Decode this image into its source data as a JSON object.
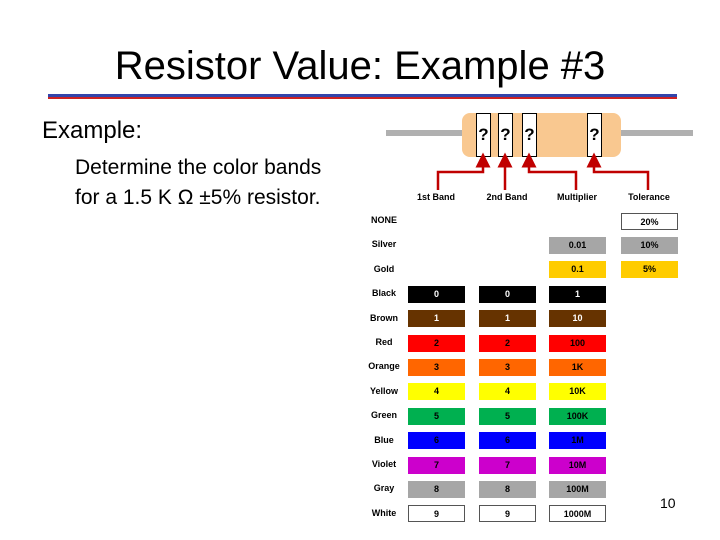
{
  "title": "Resistor Value: Example #3",
  "example_label": "Example:",
  "description": [
    "Determine the color bands",
    "for a 1.5 K Ω  ±5% resistor."
  ],
  "resistor": {
    "band_marks": [
      "?",
      "?",
      "?",
      "?"
    ],
    "body_color": "#f9c890"
  },
  "band_labels": [
    "1st Band",
    "2nd Band",
    "Multiplier",
    "Tolerance"
  ],
  "table": [
    {
      "color": "NONE",
      "hex": "#ffffff",
      "band1": "",
      "band2": "",
      "multiplier": "",
      "tolerance": "20%"
    },
    {
      "color": "Silver",
      "hex": "#a6a6a6",
      "band1": "",
      "band2": "",
      "multiplier": "0.01",
      "tolerance": "10%"
    },
    {
      "color": "Gold",
      "hex": "#ffcc00",
      "band1": "",
      "band2": "",
      "multiplier": "0.1",
      "tolerance": "5%"
    },
    {
      "color": "Black",
      "hex": "#000000",
      "band1": "0",
      "band2": "0",
      "multiplier": "1",
      "tolerance": ""
    },
    {
      "color": "Brown",
      "hex": "#663300",
      "band1": "1",
      "band2": "1",
      "multiplier": "10",
      "tolerance": ""
    },
    {
      "color": "Red",
      "hex": "#ff0000",
      "band1": "2",
      "band2": "2",
      "multiplier": "100",
      "tolerance": ""
    },
    {
      "color": "Orange",
      "hex": "#ff6600",
      "band1": "3",
      "band2": "3",
      "multiplier": "1K",
      "tolerance": ""
    },
    {
      "color": "Yellow",
      "hex": "#ffff00",
      "band1": "4",
      "band2": "4",
      "multiplier": "10K",
      "tolerance": ""
    },
    {
      "color": "Green",
      "hex": "#00b050",
      "band1": "5",
      "band2": "5",
      "multiplier": "100K",
      "tolerance": ""
    },
    {
      "color": "Blue",
      "hex": "#0000ff",
      "band1": "6",
      "band2": "6",
      "multiplier": "1M",
      "tolerance": ""
    },
    {
      "color": "Violet",
      "hex": "#cc00cc",
      "band1": "7",
      "band2": "7",
      "multiplier": "10M",
      "tolerance": ""
    },
    {
      "color": "Gray",
      "hex": "#a6a6a6",
      "band1": "8",
      "band2": "8",
      "multiplier": "100M",
      "tolerance": ""
    },
    {
      "color": "White",
      "hex": "#ffffff",
      "band1": "9",
      "band2": "9",
      "multiplier": "1000M",
      "tolerance": ""
    }
  ],
  "page_number": "10"
}
